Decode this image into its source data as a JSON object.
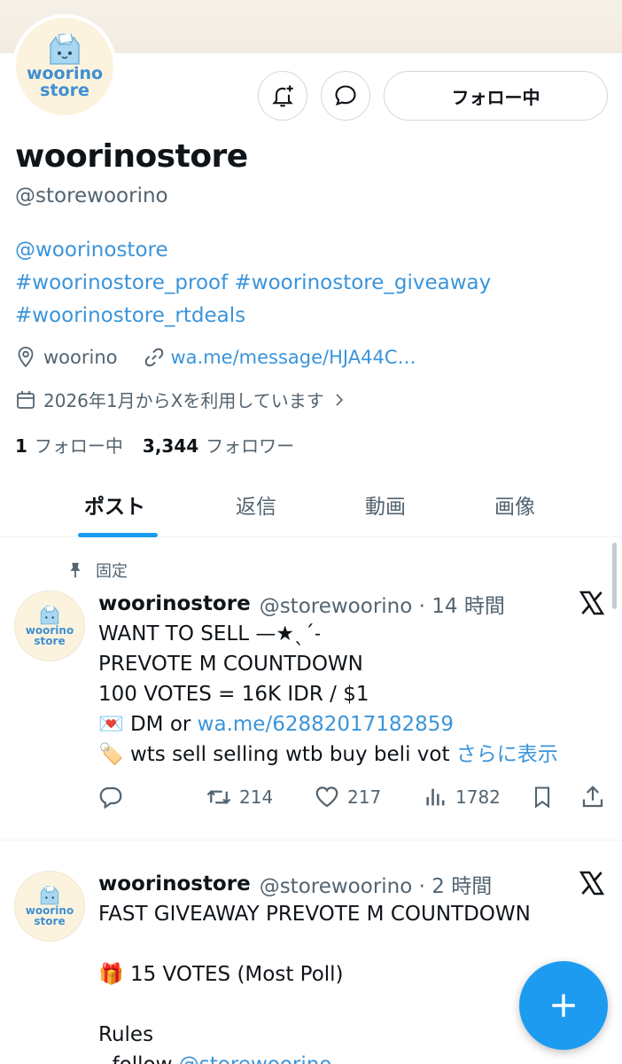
{
  "profile": {
    "logo_text_line1": "woorino",
    "logo_text_line2": "store",
    "display_name": "woorinostore",
    "handle": "@storewoorino",
    "follow_button_label": "フォロー中",
    "bio_line1": "@woorinostore",
    "bio_line2": "#woorinostore_proof #woorinostore_giveaway",
    "bio_line3": "#woorinostore_rtdeals",
    "location": "woorino",
    "website": "wa.me/message/HJA44C…",
    "joined": "2026年1月からXを利用しています",
    "following_count": "1",
    "following_label": "フォロー中",
    "followers_count": "3,344",
    "followers_label": "フォロワー"
  },
  "tabs": [
    {
      "label": "ポスト",
      "active": true
    },
    {
      "label": "返信",
      "active": false
    },
    {
      "label": "動画",
      "active": false
    },
    {
      "label": "画像",
      "active": false
    }
  ],
  "posts": [
    {
      "pinned_label": "固定",
      "name": "woorinostore",
      "handle_time": "@storewoorino · 14 時間",
      "line1": "WANT TO SELL —★ˎˊ˗",
      "line2": "PREVOTE M COUNTDOWN",
      "line3": "100 VOTES = 16K IDR / $1",
      "line4_emoji": "💌",
      "line4_prefix": "DM or ",
      "line4_link": "wa.me/62882017182859",
      "line5_emoji": "🏷️",
      "line5_text": "wts sell selling wtb buy beli vot ",
      "line5_more": "さらに表示",
      "retweets": "214",
      "likes": "217",
      "views": "1782"
    },
    {
      "name": "woorinostore",
      "handle_time": "@storewoorino · 2 時間",
      "line1": "FAST GIVEAWAY PREVOTE M COUNTDOWN",
      "line3_emoji": "🎁",
      "line3": "15 VOTES (Most Poll)",
      "line5": "Rules",
      "line6_prefix": "- follow ",
      "line6_link": "@storewoorino"
    }
  ],
  "colors": {
    "accent": "#1d9bf0",
    "link": "#3b94d9",
    "muted": "#536471",
    "text": "#0f1419"
  },
  "icons": {
    "notify": "bell-plus-icon",
    "message": "chat-bubble-icon",
    "location": "location-pin-icon",
    "link": "link-icon",
    "calendar": "calendar-icon",
    "pin": "pin-icon",
    "x_logo": "x-logo-icon",
    "reply": "reply-icon",
    "retweet": "retweet-icon",
    "like": "heart-icon",
    "views": "analytics-icon",
    "bookmark": "bookmark-icon",
    "share": "share-icon",
    "compose": "plus-icon"
  }
}
